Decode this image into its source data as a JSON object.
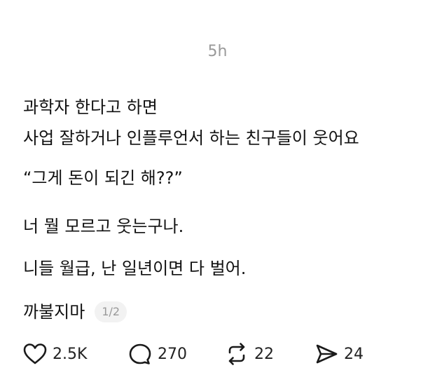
{
  "post": {
    "timestamp": "5h",
    "lines": [
      "과학자 한다고 하면",
      "사업 잘하거나 인플루언서 하는 친구들이 웃어요",
      "“그게 돈이 되긴 해??”",
      "너 뭘 모르고 웃는구나.",
      "니들 월급, 난 일년이면 다 벌어.",
      "까불지마"
    ],
    "page_indicator": "1/2"
  },
  "actions": {
    "likes": "2.5K",
    "replies": "270",
    "reposts": "22",
    "shares": "24"
  },
  "icons": {
    "like": "heart-icon",
    "reply": "comment-bubble-icon",
    "repost": "repost-icon",
    "share": "share-send-icon"
  }
}
